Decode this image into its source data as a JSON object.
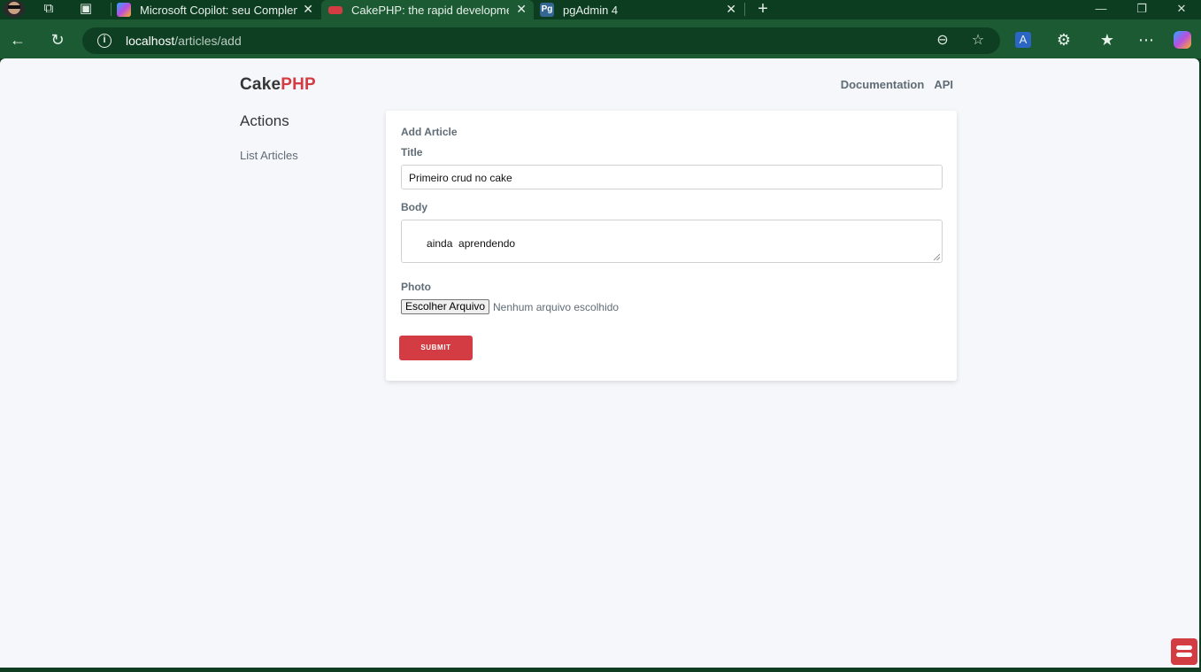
{
  "browser": {
    "tabs": [
      {
        "title": "Microsoft Copilot: seu Compleme",
        "favicon": "copilot-icon",
        "active": false
      },
      {
        "title": "CakePHP: the rapid development",
        "favicon": "cakephp-icon",
        "active": true
      },
      {
        "title": "pgAdmin 4",
        "favicon": "pgadmin-icon",
        "active": false
      }
    ],
    "address": {
      "host": "localhost",
      "path": "/articles/add"
    },
    "colors": {
      "frame": "#0d3d21",
      "toolbar": "#1b5a33"
    }
  },
  "page": {
    "brand": {
      "part1": "Cake",
      "part2": "PHP"
    },
    "nav": {
      "documentation": "Documentation",
      "api": "API"
    },
    "sidebar": {
      "heading": "Actions",
      "list_link": "List Articles"
    },
    "form": {
      "legend": "Add Article",
      "title_label": "Title",
      "title_value": "Primeiro crud no cake",
      "body_label": "Body",
      "body_value": "ainda  aprendendo",
      "photo_label": "Photo",
      "file_button": "Escolher Arquivo",
      "file_status": "Nenhum arquivo escolhido",
      "submit_label": "SUBMIT"
    },
    "colors": {
      "accent": "#d33c43",
      "text": "#606c76",
      "background": "#f5f7fa"
    }
  }
}
